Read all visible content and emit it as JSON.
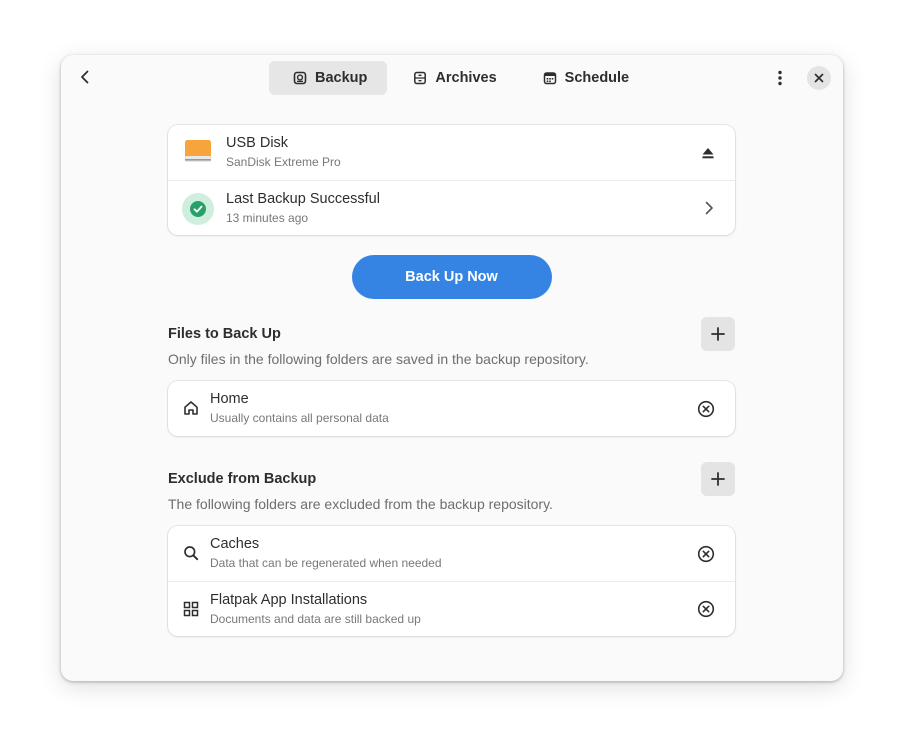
{
  "header": {
    "tabs": [
      {
        "label": "Backup",
        "icon": "backup-icon",
        "active": true
      },
      {
        "label": "Archives",
        "icon": "archives-icon",
        "active": false
      },
      {
        "label": "Schedule",
        "icon": "schedule-icon",
        "active": false
      }
    ]
  },
  "status": {
    "disk": {
      "title": "USB Disk",
      "subtitle": "SanDisk Extreme Pro"
    },
    "last_backup": {
      "title": "Last Backup Successful",
      "subtitle": "13 minutes ago"
    }
  },
  "actions": {
    "backup_now_label": "Back Up Now"
  },
  "include": {
    "title": "Files to Back Up",
    "description": "Only files in the following folders are saved in the backup repository.",
    "items": [
      {
        "title": "Home",
        "subtitle": "Usually contains all personal data",
        "icon": "home-icon"
      }
    ]
  },
  "exclude": {
    "title": "Exclude from Backup",
    "description": "The following folders are excluded from the backup repository.",
    "items": [
      {
        "title": "Caches",
        "subtitle": "Data that can be regenerated when needed",
        "icon": "search-icon"
      },
      {
        "title": "Flatpak App Installations",
        "subtitle": "Documents and data are still backed up",
        "icon": "apps-grid-icon"
      }
    ]
  },
  "colors": {
    "accent": "#3584e4",
    "success": "#26a269",
    "disk": "#f6a53c"
  }
}
